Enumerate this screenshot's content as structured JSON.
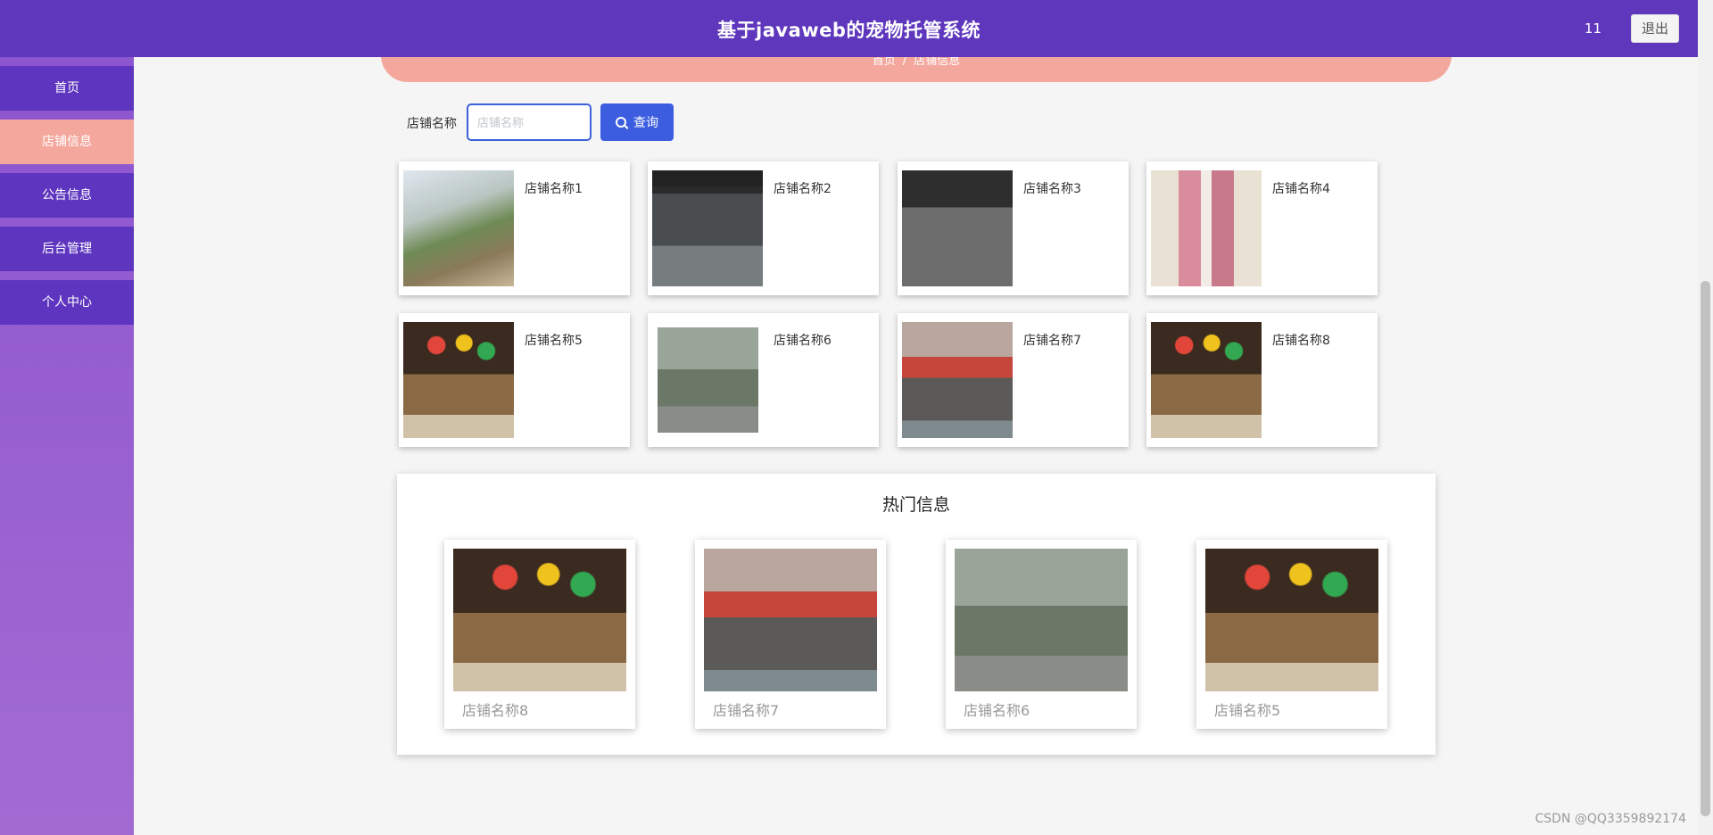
{
  "header": {
    "title": "基于javaweb的宠物托管系统",
    "user": "11",
    "logout_label": "退出"
  },
  "sidebar": {
    "items": [
      {
        "label": "首页",
        "active": false
      },
      {
        "label": "店铺信息",
        "active": true
      },
      {
        "label": "公告信息",
        "active": false
      },
      {
        "label": "后台管理",
        "active": false
      },
      {
        "label": "个人中心",
        "active": false
      }
    ]
  },
  "breadcrumb": {
    "home": "首页",
    "separator": "/",
    "current": "店铺信息"
  },
  "search": {
    "label": "店铺名称",
    "placeholder": "店铺名称",
    "value": "",
    "button_label": "查询"
  },
  "shops": [
    {
      "name": "店铺名称1"
    },
    {
      "name": "店铺名称2"
    },
    {
      "name": "店铺名称3"
    },
    {
      "name": "店铺名称4"
    },
    {
      "name": "店铺名称5"
    },
    {
      "name": "店铺名称6"
    },
    {
      "name": "店铺名称7"
    },
    {
      "name": "店铺名称8"
    }
  ],
  "hot": {
    "title": "热门信息",
    "items": [
      {
        "name": "店铺名称8"
      },
      {
        "name": "店铺名称7"
      },
      {
        "name": "店铺名称6"
      },
      {
        "name": "店铺名称5"
      }
    ]
  },
  "watermark": "CSDN @QQ3359892174",
  "colors": {
    "header": "#5e37bd",
    "accent": "#f4a89d",
    "button": "#3c5de0"
  }
}
